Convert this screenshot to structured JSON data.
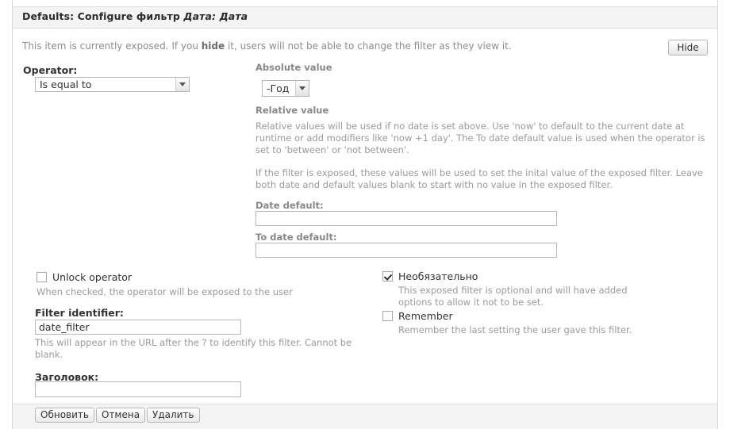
{
  "panel": {
    "title_main": "Defaults: Configure фильтр",
    "title_em": "Дата: Дата",
    "exposed_note_pre": "This item is currently exposed. If you ",
    "exposed_note_bold": "hide",
    "exposed_note_post": " it, users will not be able to change the filter as they view it.",
    "hide_button": "Hide"
  },
  "operator": {
    "label": "Operator:",
    "value": "Is equal to"
  },
  "absolute": {
    "label": "Absolute value",
    "value": "-Год"
  },
  "relative": {
    "label": "Relative value",
    "paragraph1": "Relative values will be used if no date is set above. Use 'now' to default to the current date at runtime or add modifiers like 'now +1 day'. The To date default value is used when the operator is set to 'between' or 'not between'.",
    "paragraph2": "If the filter is exposed, these values will be used to set the inital value of the exposed filter. Leave both date and default values blank to start with no value in the exposed filter."
  },
  "date_default": {
    "label": "Date default:",
    "value": ""
  },
  "todate_default": {
    "label": "To date default:",
    "value": ""
  },
  "unlock_operator": {
    "label": "Unlock operator",
    "description": "When checked, the operator will be exposed to the user",
    "checked": false
  },
  "filter_identifier": {
    "label": "Filter identifier:",
    "value": "date_filter",
    "description": "This will appear in the URL after the ? to identify this filter. Cannot be blank."
  },
  "optional": {
    "label": "Необязательно",
    "description": "This exposed filter is optional and will have added options to allow it not to be set.",
    "checked": true
  },
  "remember": {
    "label": "Remember",
    "description": "Remember the last setting the user gave this filter.",
    "checked": false
  },
  "heading": {
    "label": "Заголовок:",
    "value": ""
  },
  "footer": {
    "update": "Обновить",
    "cancel": "Отмена",
    "delete": "Удалить"
  },
  "colors": {
    "header_bg": "#f4f4f4",
    "border": "#dcdcdc",
    "text": "#333333",
    "muted": "#9a9a9a"
  }
}
